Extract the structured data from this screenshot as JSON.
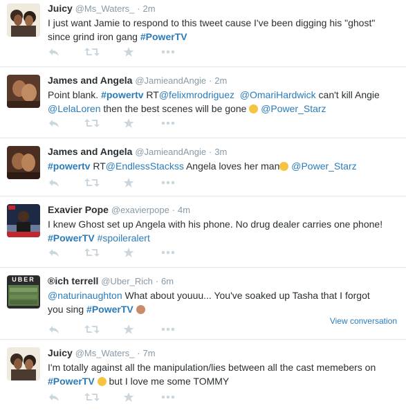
{
  "tweets": [
    {
      "name": "Juicy",
      "handle": "@Ms_Waters_",
      "sep": "·",
      "time": "2m",
      "line1": "I just want Jamie to respond to this tweet cause I've been digging his \"ghost\"",
      "line2a": "since grind iron gang ",
      "line2tag": "#PowerTV"
    },
    {
      "name": "James and Angela",
      "handle": "@JamieandAngie",
      "sep": "·",
      "time": "2m",
      "l1a": "Point blank. ",
      "l1tag": "#powertv",
      "l1b": " RT",
      "l1m1": "@felixmrodriguez",
      "l1c": "  ",
      "l1m2": "@OmariHardwick",
      "l1d": " can't kill Angie",
      "l2m1": "@LelaLoren",
      "l2a": " then the best scenes will be gone ",
      "l2m2": "@Power_Starz"
    },
    {
      "name": "James and Angela",
      "handle": "@JamieandAngie",
      "sep": "·",
      "time": "3m",
      "tag": "#powertv",
      "a": " RT",
      "m1": "@EndlessStackss",
      "b": " Angela loves her man",
      "m2": "@Power_Starz"
    },
    {
      "name": "Exavier Pope",
      "handle": "@exavierpope",
      "sep": "·",
      "time": "4m",
      "line1": "I knew Ghost set up Angela with his phone. No drug dealer carries one phone!",
      "tag1": "#PowerTV",
      "tag2": "#spoileralert"
    },
    {
      "name": "®ich terrell",
      "handle": "@Uber_Rich",
      "sep": "·",
      "time": "6m",
      "m1": "@naturinaughton",
      "l1": " What about youuu... You've soaked up Tasha that I forgot",
      "l2a": "you sing ",
      "tag": "#PowerTV",
      "view_conversation": "View conversation",
      "avatar_text": "UBER"
    },
    {
      "name": "Juicy",
      "handle": "@Ms_Waters_",
      "sep": "·",
      "time": "7m",
      "line1": "I'm totally against all the manipulation/lies between all the cast memebers on",
      "tag": "#PowerTV",
      "line2b": " but I love me some TOMMY"
    }
  ],
  "icons": [
    "reply-icon",
    "retweet-icon",
    "favorite-icon",
    "more-icon"
  ],
  "colors": {
    "link": "#2b7bb9",
    "muted": "#8899a6",
    "icon": "#ccd6dd",
    "border": "#e1e8ed"
  }
}
